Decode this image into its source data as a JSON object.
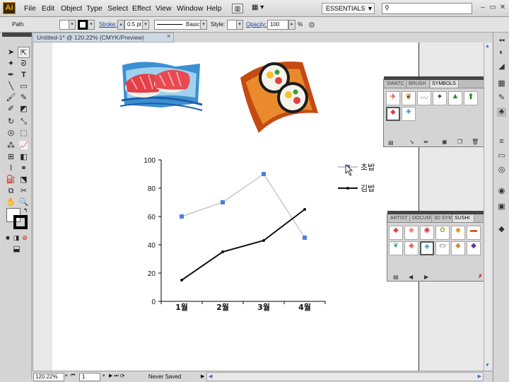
{
  "app": {
    "logo": "Ai"
  },
  "menu": [
    "File",
    "Edit",
    "Object",
    "Type",
    "Select",
    "Effect",
    "View",
    "Window",
    "Help"
  ],
  "workspace": {
    "label": "ESSENTIALS ▼"
  },
  "window_controls": [
    "–",
    "▭",
    "✕"
  ],
  "control_bar": {
    "selection": "Path",
    "stroke_label": "Stroke:",
    "stroke_value": "0.5 pt",
    "brush_value": "Basic",
    "style_label": "Style:",
    "opacity_label": "Opacity:",
    "opacity_value": "100",
    "percent": "%"
  },
  "document": {
    "tab_title": "Untitled-1* @ 120.22% (CMYK/Preview)",
    "close": "×"
  },
  "status_bar": {
    "zoom": "120.22%",
    "page": "1",
    "save_state": "Never Saved"
  },
  "symbols_panel": {
    "tabs": [
      "SWATC",
      "BRUSH",
      "SYMBOLS"
    ],
    "active_tab": "SYMBOLS"
  },
  "sushi_panel": {
    "tabs": [
      "ARTIST",
      "DOCUM",
      "3D SYM",
      "SUSHI"
    ],
    "active_tab": "SUSHI"
  },
  "chart_data": {
    "type": "line",
    "categories": [
      "1월",
      "2월",
      "3월",
      "4월"
    ],
    "series": [
      {
        "name": "초밥",
        "values": [
          60,
          70,
          90,
          45
        ],
        "color": "#4a7fe0",
        "line_color": "#c8c8c8"
      },
      {
        "name": "김밥",
        "values": [
          15,
          35,
          43,
          65
        ],
        "color": "#111111",
        "line_color": "#111111"
      }
    ],
    "yticks": [
      0,
      20,
      40,
      60,
      80,
      100
    ],
    "ylim": [
      0,
      100
    ],
    "legend_position": "right"
  },
  "colors": {
    "accent": "#1a4aa8",
    "canvas": "#e9e9e9",
    "ui_grey": "#d6d6d6"
  }
}
